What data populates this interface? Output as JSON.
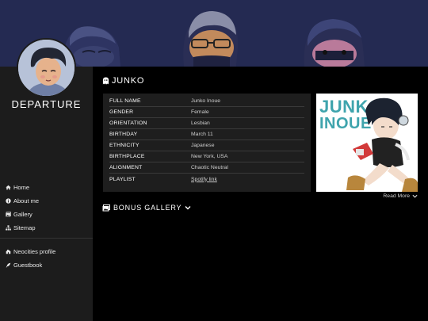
{
  "site": {
    "title": "DEPARTURE"
  },
  "sidebar": {
    "items": [
      {
        "label": "Home",
        "icon": "home-icon"
      },
      {
        "label": "About me",
        "icon": "info-icon"
      },
      {
        "label": "Gallery",
        "icon": "images-icon"
      },
      {
        "label": "Sitemap",
        "icon": "sitemap-icon"
      }
    ],
    "external": [
      {
        "label": "Neocities profile",
        "icon": "neocities-icon"
      },
      {
        "label": "Guestbook",
        "icon": "feather-icon"
      }
    ]
  },
  "character": {
    "name": "JUNKO",
    "rows": [
      {
        "key": "FULL NAME",
        "value": "Junko Inoue"
      },
      {
        "key": "GENDER",
        "value": "Female"
      },
      {
        "key": "ORIENTATION",
        "value": "Lesbian"
      },
      {
        "key": "BIRTHDAY",
        "value": "March 11"
      },
      {
        "key": "ETHNICITY",
        "value": "Japanese"
      },
      {
        "key": "BIRTHPLACE",
        "value": "New York, USA"
      },
      {
        "key": "ALIGNMENT",
        "value": "Chaotic Neutral"
      },
      {
        "key": "PLAYLIST",
        "value": "Spotify link"
      }
    ],
    "portrait_text": "JUNKO INOUE",
    "read_more": "Read More"
  },
  "bonus": {
    "label": "BONUS GALLERY"
  },
  "colors": {
    "banner": "#242a52",
    "sidebar": "#1c1c1c",
    "panel": "#1e1e1e",
    "background": "#000000"
  }
}
